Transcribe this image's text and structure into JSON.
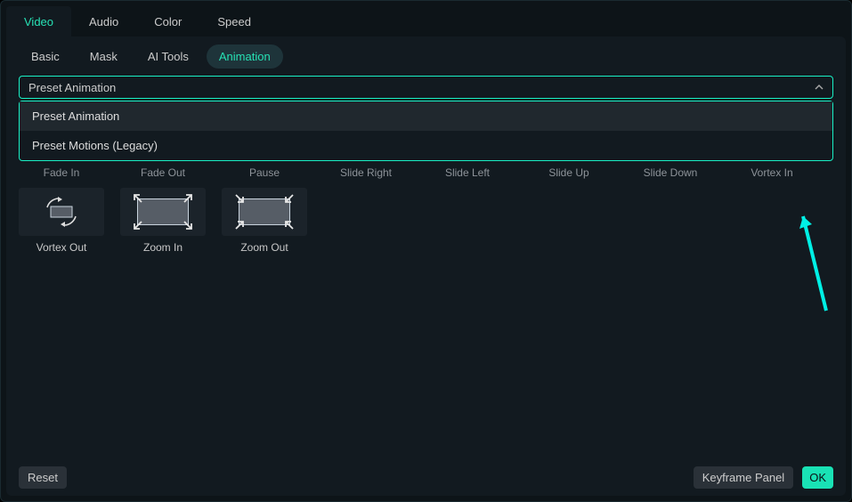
{
  "outerTabs": {
    "items": [
      {
        "label": "Video",
        "active": true
      },
      {
        "label": "Audio",
        "active": false
      },
      {
        "label": "Color",
        "active": false
      },
      {
        "label": "Speed",
        "active": false
      }
    ]
  },
  "innerTabs": {
    "items": [
      {
        "label": "Basic",
        "active": false
      },
      {
        "label": "Mask",
        "active": false
      },
      {
        "label": "AI Tools",
        "active": false
      },
      {
        "label": "Animation",
        "active": true
      }
    ]
  },
  "dropdown": {
    "selected": "Preset Animation",
    "options": [
      {
        "label": "Preset Animation",
        "hover": true
      },
      {
        "label": "Preset Motions (Legacy)",
        "hover": false
      }
    ]
  },
  "row1Labels": [
    "Fade In",
    "Fade Out",
    "Pause",
    "Slide Right",
    "Slide Left",
    "Slide Up",
    "Slide Down",
    "Vortex In"
  ],
  "row2": [
    {
      "label": "Vortex Out",
      "icon": "vortex-out"
    },
    {
      "label": "Zoom In",
      "icon": "zoom-in"
    },
    {
      "label": "Zoom Out",
      "icon": "zoom-out"
    }
  ],
  "footer": {
    "reset": "Reset",
    "keyframe": "Keyframe Panel",
    "ok": "OK"
  },
  "colors": {
    "accent": "#19e2b5",
    "arrow": "#00f0e5"
  }
}
